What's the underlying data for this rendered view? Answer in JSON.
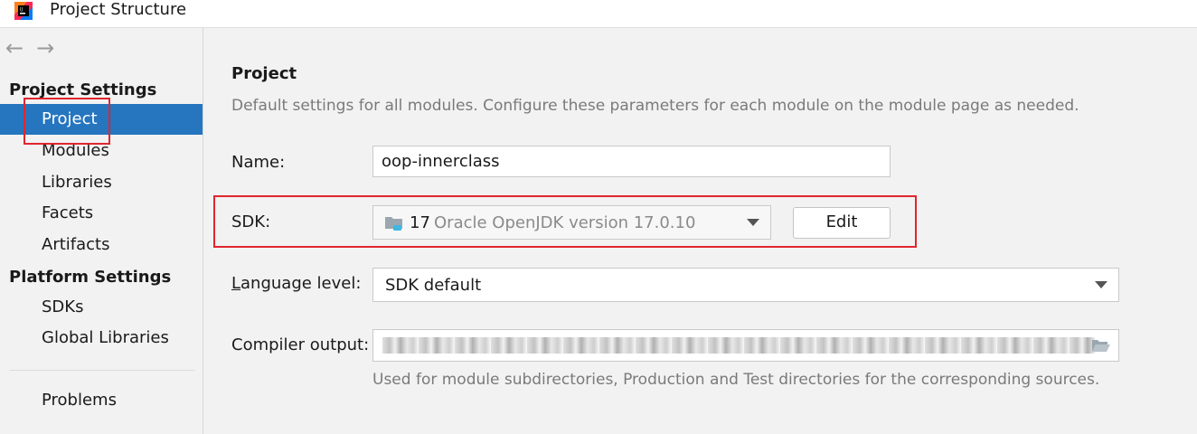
{
  "window": {
    "title": "Project Structure"
  },
  "sidebar": {
    "sections": [
      {
        "title": "Project Settings",
        "items": [
          {
            "label": "Project",
            "selected": true
          },
          {
            "label": "Modules"
          },
          {
            "label": "Libraries"
          },
          {
            "label": "Facets"
          },
          {
            "label": "Artifacts"
          }
        ]
      },
      {
        "title": "Platform Settings",
        "items": [
          {
            "label": "SDKs"
          },
          {
            "label": "Global Libraries"
          }
        ]
      }
    ],
    "problems_label": "Problems"
  },
  "main": {
    "title": "Project",
    "description": "Default settings for all modules. Configure these parameters for each module on the module page as needed.",
    "name": {
      "label": "Name:",
      "value": "oop-innerclass"
    },
    "sdk": {
      "label": "SDK:",
      "version_number": "17",
      "version_text": "Oracle OpenJDK version 17.0.10",
      "edit_label": "Edit"
    },
    "language_level": {
      "label_underlined": "L",
      "label_rest": "anguage level:",
      "value": "SDK default"
    },
    "compiler_output": {
      "label": "Compiler output:",
      "hint": "Used for module subdirectories, Production and Test directories for the corresponding sources."
    }
  },
  "colors": {
    "selection": "#2675bf",
    "highlight_box": "#e0262e"
  },
  "icons": {
    "app": "intellij-idea-icon",
    "back": "back-arrow-icon",
    "forward": "forward-arrow-icon",
    "sdk": "jdk-folder-icon",
    "browse": "folder-open-icon"
  }
}
